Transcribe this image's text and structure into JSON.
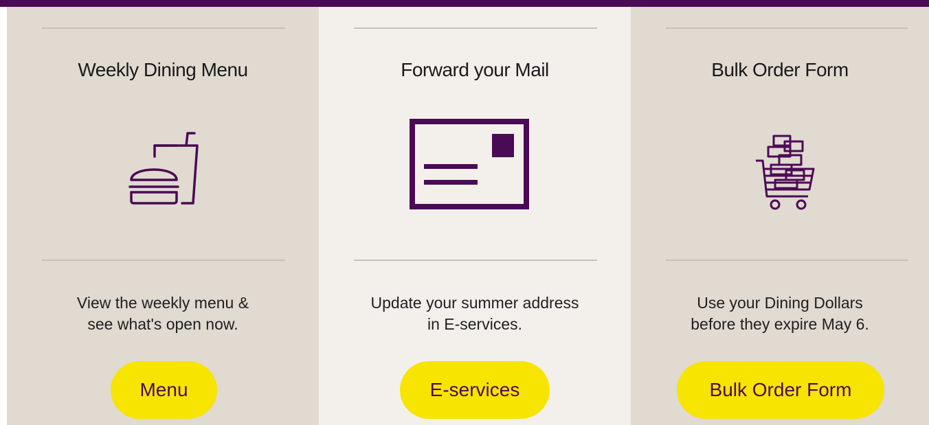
{
  "colors": {
    "brand_purple": "#4b0a55",
    "button_yellow": "#f7e400",
    "card_tan": "#e0dad1",
    "card_light": "#f3f0ec"
  },
  "cards": [
    {
      "title": "Weekly Dining Menu",
      "icon": "burger-and-drink-icon",
      "description_line1": "View the weekly menu &",
      "description_line2": "see what's open now.",
      "button_label": "Menu"
    },
    {
      "title": "Forward your Mail",
      "icon": "postcard-icon",
      "description_line1": "Update your summer address",
      "description_line2": "in E-services.",
      "button_label": "E-services"
    },
    {
      "title": "Bulk Order Form",
      "icon": "shopping-cart-boxes-icon",
      "description_line1": "Use your Dining Dollars",
      "description_line2": "before they expire May 6.",
      "button_label": "Bulk Order Form"
    }
  ]
}
